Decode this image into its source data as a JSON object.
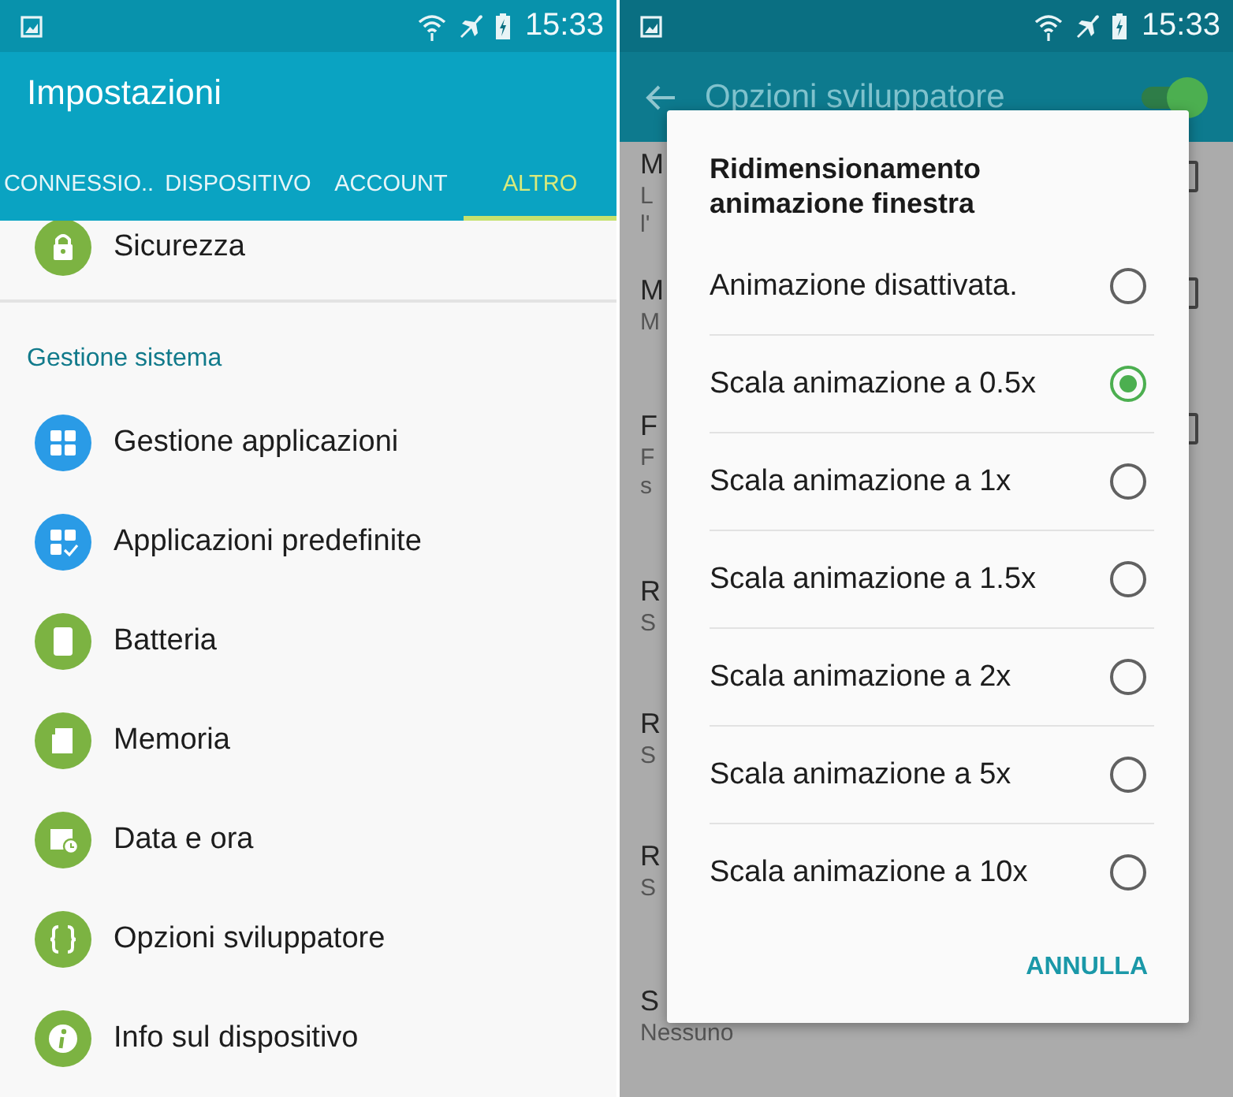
{
  "left": {
    "status_bar": {
      "time": "15:33"
    },
    "title": "Impostazioni",
    "tabs": [
      {
        "label": "CONNESSIO..",
        "selected": false
      },
      {
        "label": "DISPOSITIVO",
        "selected": false
      },
      {
        "label": "ACCOUNT",
        "selected": false
      },
      {
        "label": "ALTRO",
        "selected": true
      }
    ],
    "top_item": {
      "label": "Sicurezza",
      "color": "#7cb342"
    },
    "section": "Gestione sistema",
    "items": [
      {
        "label": "Gestione applicazioni",
        "color": "#2a9be6"
      },
      {
        "label": "Applicazioni predefinite",
        "color": "#2a9be6"
      },
      {
        "label": "Batteria",
        "color": "#7cb342"
      },
      {
        "label": "Memoria",
        "color": "#7cb342"
      },
      {
        "label": "Data e ora",
        "color": "#7cb342"
      },
      {
        "label": "Opzioni sviluppatore",
        "color": "#7cb342"
      },
      {
        "label": "Info sul dispositivo",
        "color": "#7cb342"
      }
    ]
  },
  "right": {
    "status_bar": {
      "time": "15:33"
    },
    "title": "Opzioni sviluppatore",
    "switch_on": true,
    "background_rows": [
      {
        "title": "M",
        "subtitle": [
          "L",
          "l'"
        ],
        "checkbox": true
      },
      {
        "title": "M",
        "subtitle": [
          "M"
        ],
        "checkbox": true
      },
      {
        "title": "F",
        "subtitle": [
          "F",
          "s"
        ],
        "checkbox": true
      },
      {
        "title": "R",
        "subtitle": [
          "S"
        ],
        "checkbox": false
      },
      {
        "title": "R",
        "subtitle": [
          "S"
        ],
        "checkbox": false
      },
      {
        "title": "R",
        "subtitle": [
          "S"
        ],
        "checkbox": false
      },
      {
        "title": "S",
        "subtitle": [
          "Nessuno"
        ],
        "checkbox": false
      }
    ],
    "dialog": {
      "title": "Ridimensionamento animazione finestra",
      "options": [
        {
          "label": "Animazione disattivata.",
          "selected": false
        },
        {
          "label": "Scala animazione a 0.5x",
          "selected": true
        },
        {
          "label": "Scala animazione a 1x",
          "selected": false
        },
        {
          "label": "Scala animazione a 1.5x",
          "selected": false
        },
        {
          "label": "Scala animazione a 2x",
          "selected": false
        },
        {
          "label": "Scala animazione a 5x",
          "selected": false
        },
        {
          "label": "Scala animazione a 10x",
          "selected": false
        }
      ],
      "cancel": "ANNULLA"
    }
  }
}
